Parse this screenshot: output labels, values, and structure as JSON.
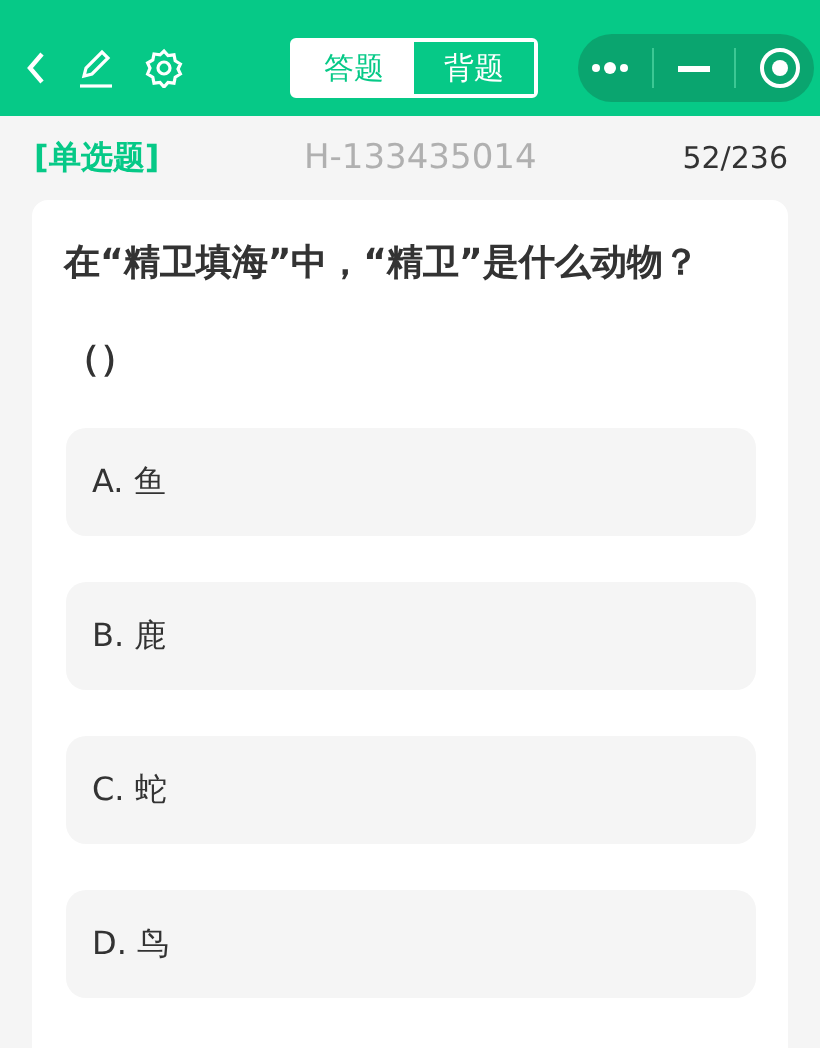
{
  "toolbar": {
    "tabs": [
      {
        "label": "答题",
        "selected": false
      },
      {
        "label": "背题",
        "selected": true
      }
    ]
  },
  "info_bar": {
    "type_label": "[单选题]",
    "question_id": "H-133435014",
    "progress": "52/236"
  },
  "question": {
    "text": "在“精卫填海”中，“精卫”是什么动物？（）",
    "options": [
      {
        "text": "A. 鱼",
        "selected": false
      },
      {
        "text": "B. 鹿",
        "selected": false
      },
      {
        "text": "C. 蛇",
        "selected": false
      },
      {
        "text": "D. 鸟",
        "selected": false
      }
    ]
  }
}
